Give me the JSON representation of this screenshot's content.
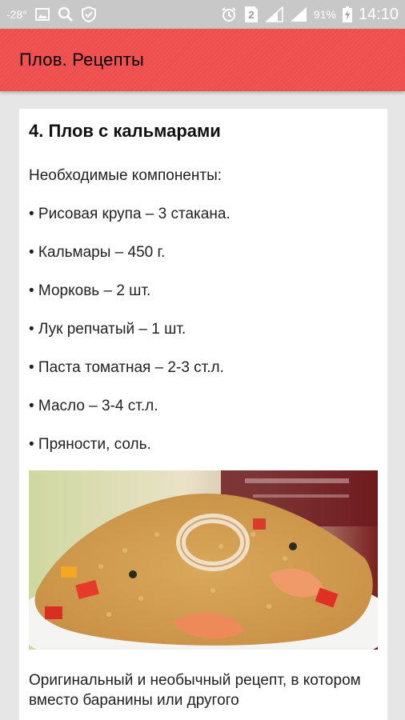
{
  "status_bar": {
    "temperature": "-28°",
    "battery_percent": "91%",
    "sim_badge": "2",
    "time": "14:10",
    "left_icons": [
      "picture-icon",
      "search-icon",
      "shield-icon"
    ],
    "right_icons": [
      "alarm-icon",
      "sim-icon",
      "signal-icon",
      "signal-icon",
      "battery-charging-icon"
    ]
  },
  "app_bar": {
    "title": "Плов. Рецепты",
    "color": "#f25454"
  },
  "recipe": {
    "title": "4. Плов с кальмарами",
    "intro": "Необходимые компоненты:",
    "ingredients": [
      "• Рисовая крупа – 3 стакана.",
      "• Кальмары – 450 г.",
      "• Морковь – 2 шт.",
      "• Лук репчатый – 1 шт.",
      "• Паста томатная – 2-3 ст.л.",
      "• Масло – 3-4 ст.л.",
      "• Пряности, соль."
    ],
    "after_text": "Оригинальный и необычный рецепт, в котором вместо баранины или другого"
  }
}
